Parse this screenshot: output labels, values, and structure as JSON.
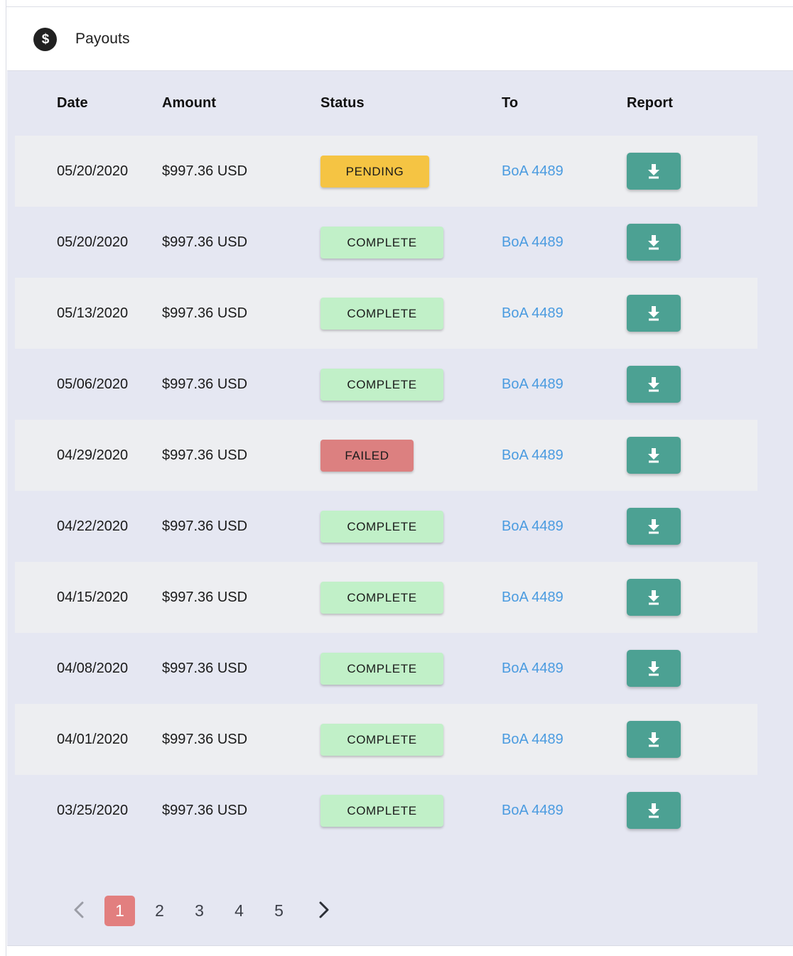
{
  "header": {
    "icon": "dollar-circle-icon",
    "title": "Payouts"
  },
  "table": {
    "columns": [
      {
        "key": "date",
        "label": "Date"
      },
      {
        "key": "amount",
        "label": "Amount"
      },
      {
        "key": "status",
        "label": "Status"
      },
      {
        "key": "to",
        "label": "To"
      },
      {
        "key": "report",
        "label": "Report"
      }
    ],
    "rows": [
      {
        "date": "05/20/2020",
        "amount": "$997.36 USD",
        "status": "PENDING",
        "status_kind": "pending",
        "to": "BoA 4489",
        "report_icon": "download-icon"
      },
      {
        "date": "05/20/2020",
        "amount": "$997.36 USD",
        "status": "COMPLETE",
        "status_kind": "complete",
        "to": "BoA 4489",
        "report_icon": "download-icon"
      },
      {
        "date": "05/13/2020",
        "amount": "$997.36 USD",
        "status": "COMPLETE",
        "status_kind": "complete",
        "to": "BoA 4489",
        "report_icon": "download-icon"
      },
      {
        "date": "05/06/2020",
        "amount": "$997.36 USD",
        "status": "COMPLETE",
        "status_kind": "complete",
        "to": "BoA 4489",
        "report_icon": "download-icon"
      },
      {
        "date": "04/29/2020",
        "amount": "$997.36 USD",
        "status": "FAILED",
        "status_kind": "failed",
        "to": "BoA 4489",
        "report_icon": "download-icon"
      },
      {
        "date": "04/22/2020",
        "amount": "$997.36 USD",
        "status": "COMPLETE",
        "status_kind": "complete",
        "to": "BoA 4489",
        "report_icon": "download-icon"
      },
      {
        "date": "04/15/2020",
        "amount": "$997.36 USD",
        "status": "COMPLETE",
        "status_kind": "complete",
        "to": "BoA 4489",
        "report_icon": "download-icon"
      },
      {
        "date": "04/08/2020",
        "amount": "$997.36 USD",
        "status": "COMPLETE",
        "status_kind": "complete",
        "to": "BoA 4489",
        "report_icon": "download-icon"
      },
      {
        "date": "04/01/2020",
        "amount": "$997.36 USD",
        "status": "COMPLETE",
        "status_kind": "complete",
        "to": "BoA 4489",
        "report_icon": "download-icon"
      },
      {
        "date": "03/25/2020",
        "amount": "$997.36 USD",
        "status": "COMPLETE",
        "status_kind": "complete",
        "to": "BoA 4489",
        "report_icon": "download-icon"
      }
    ]
  },
  "pagination": {
    "prev_icon": "chevron-left-icon",
    "next_icon": "chevron-right-icon",
    "pages": [
      "1",
      "2",
      "3",
      "4",
      "5"
    ],
    "active_page": "1",
    "prev_enabled": false,
    "next_enabled": true
  },
  "colors": {
    "page_background": "#e5e7f2",
    "row_alt_background": "#edeef1",
    "status_pending": "#f5c443",
    "status_complete": "#c1f0c8",
    "status_failed": "#dc8080",
    "download_button": "#4ca193",
    "link": "#4a9be0",
    "active_page": "#e27f7f",
    "icon_dark": "#212121"
  }
}
